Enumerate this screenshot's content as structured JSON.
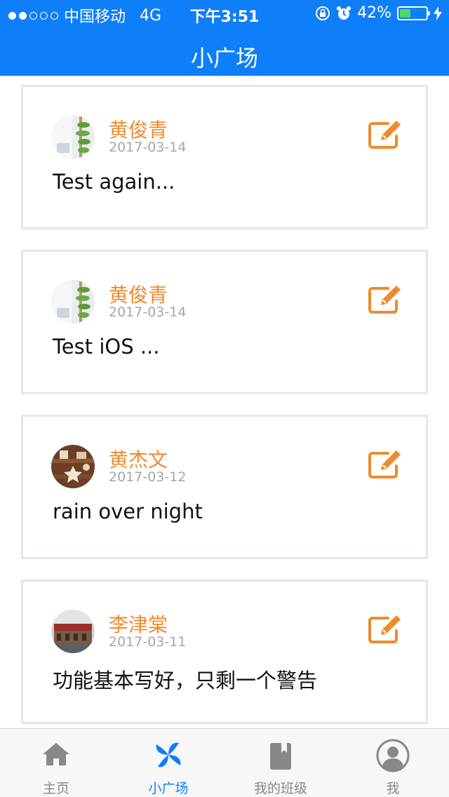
{
  "status_bar": {
    "carrier": "中国移动",
    "network": "4G",
    "time": "下午3:51",
    "battery_percent": "42%",
    "battery_level": 0.42
  },
  "header": {
    "title": "小广场"
  },
  "posts": [
    {
      "author": "黄俊青",
      "date": "2017-03-14",
      "content": "Test again...",
      "avatar_icon": "plants-avatar-icon"
    },
    {
      "author": "黄俊青",
      "date": "2017-03-14",
      "content": "Test iOS ...",
      "avatar_icon": "plants-avatar-icon"
    },
    {
      "author": "黄杰文",
      "date": "2017-03-12",
      "content": "rain over night",
      "avatar_icon": "cookies-avatar-icon"
    },
    {
      "author": "李津棠",
      "date": "2017-03-11",
      "content": "功能基本写好，只剩一个警告",
      "avatar_icon": "building-avatar-icon"
    }
  ],
  "tabbar": {
    "items": [
      {
        "label": "主页",
        "icon": "home-icon",
        "active": false
      },
      {
        "label": "小广场",
        "icon": "pinwheel-icon",
        "active": true
      },
      {
        "label": "我的班级",
        "icon": "book-icon",
        "active": false
      },
      {
        "label": "我",
        "icon": "user-icon",
        "active": false
      }
    ]
  },
  "colors": {
    "primary": "#0f7ef9",
    "accent": "#ee8b2c",
    "card_border": "#e1e7ee",
    "date_text": "#a6a6a6",
    "tab_inactive": "#888888"
  }
}
